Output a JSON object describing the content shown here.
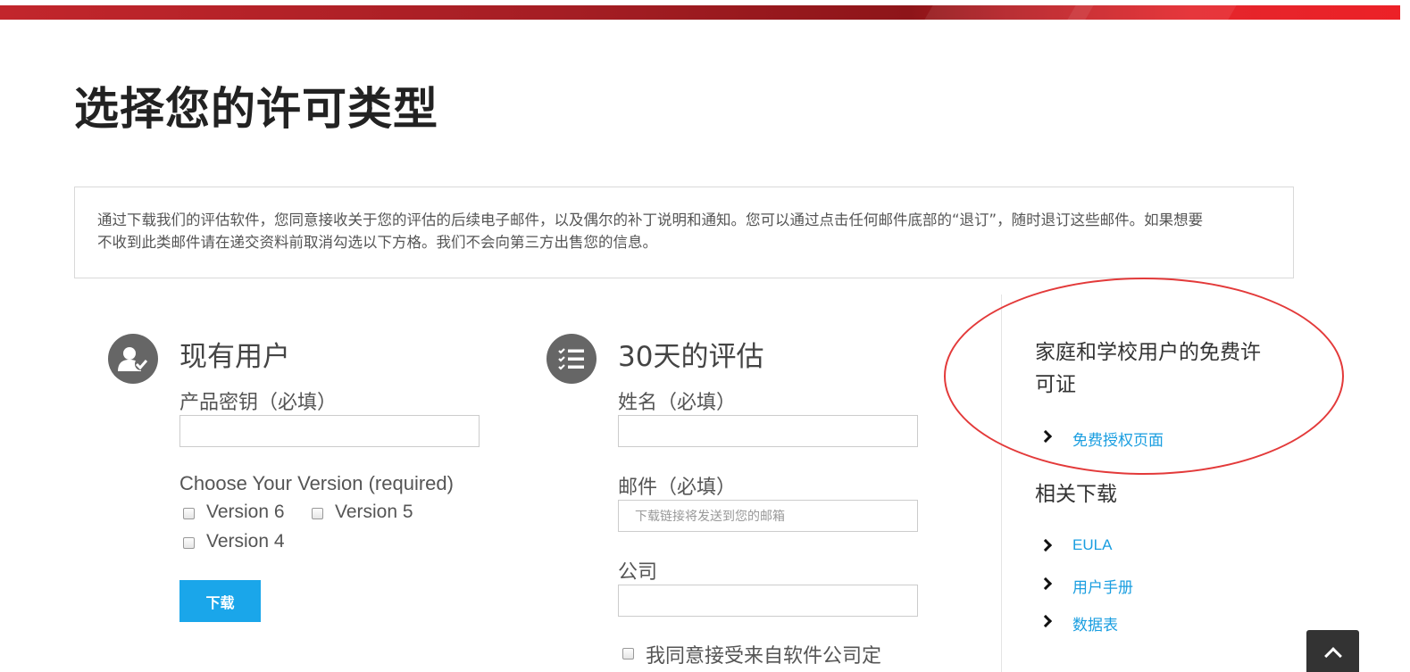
{
  "page_title": "选择您的许可类型",
  "notice": {
    "line1": "通过下载我们的评估软件，您同意接收关于您的评估的后续电子邮件，以及偶尔的补丁说明和通知。您可以通过点击任何邮件底部的“退订”，随时退订这些邮件。如果想要",
    "line2": "不收到此类邮件请在递交资料前取消勾选以下方格。我们不会向第三方出售您的信息。"
  },
  "existing_user": {
    "icon": "user-check-icon",
    "title": "现有用户",
    "product_key_label": "产品密钥（必填）",
    "product_key_value": "",
    "version_label": "Choose Your Version (required)",
    "versions": [
      "Version 6",
      "Version 5",
      "Version 4"
    ],
    "download_label": "下载"
  },
  "evaluation": {
    "icon": "checklist-icon",
    "title": "30天的评估",
    "name_label": "姓名（必填）",
    "name_value": "",
    "email_label": "邮件（必填）",
    "email_placeholder": "下载链接将发送到您的邮箱",
    "company_label": "公司",
    "company_value": "",
    "consent_label": "我同意接受来自软件公司定"
  },
  "sidebar": {
    "free_license_heading_line1": "家庭和学校用户的免费许",
    "free_license_heading_line2": "可证",
    "free_license_link": "免费授权页面",
    "related_heading": "相关下载",
    "related_links": [
      "EULA",
      "用户手册",
      "数据表"
    ]
  },
  "colors": {
    "brand_red": "#c2262c",
    "button_blue": "#1aa6ea",
    "link_blue": "#1a9ee0",
    "annotation_red": "#e33a3a"
  },
  "back_to_top_icon": "chevron-up-icon"
}
